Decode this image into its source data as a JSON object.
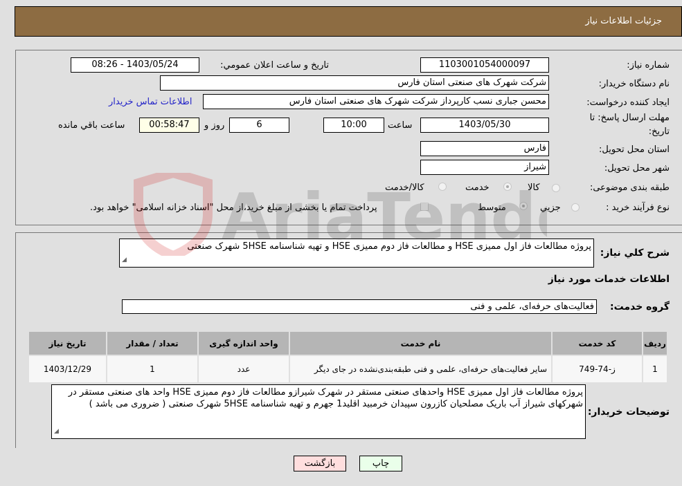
{
  "header": {
    "title": "جزئیات اطلاعات نیاز"
  },
  "fields": {
    "need_number_label": "شماره نیاز:",
    "need_number": "1103001054000097",
    "announce_label": "تاریخ و ساعت اعلان عمومي:",
    "announce_value": "1403/05/24 - 08:26",
    "buyer_org_label": "نام دستگاه خریدار:",
    "buyer_org": "شرکت شهرک های صنعتی استان فارس",
    "creator_label": "ایجاد کننده درخواست:",
    "creator": "محسن  جباری نسب کارپرداز شرکت شهرک های صنعتی استان فارس",
    "contact_link": "اطلاعات تماس خریدار",
    "deadline_label_1": "مهلت ارسال پاسخ: تا",
    "deadline_label_2": "تاریخ:",
    "deadline_date": "1403/05/30",
    "time_label": "ساعت",
    "deadline_time": "10:00",
    "days": "6",
    "days_label": "روز و",
    "remaining": "00:58:47",
    "remaining_label": "ساعت باقي مانده",
    "province_label": "استان محل تحویل:",
    "province": "فارس",
    "city_label": "شهر محل تحویل:",
    "city": "شیراز",
    "category_label": "طبقه بندی موضوعی:",
    "category_options": [
      {
        "label": "کالا",
        "selected": false
      },
      {
        "label": "خدمت",
        "selected": true
      },
      {
        "label": "کالا/خدمت",
        "selected": false
      }
    ],
    "process_label": "نوع فرآیند خرید :",
    "process_options": [
      {
        "label": "جزيي",
        "selected": false
      },
      {
        "label": "متوسط",
        "selected": true
      }
    ],
    "treasury_checkbox_label": "پرداخت تمام یا بخشی از مبلغ خرید،از محل \"اسناد خزانه اسلامی\" خواهد بود.",
    "treasury_checked": false
  },
  "description": {
    "label": "شرح كلي نیاز:",
    "value": "پروژه مطالعات فاز اول ممیزی HSE  و مطالعات فاز دوم ممیزی HSE  و تهیه شناسنامه   5HSE   شهرک صنعتی"
  },
  "services_title": "اطلاعات خدمات مورد نیاز",
  "service_group": {
    "label": "گروه خدمت:",
    "value": "فعالیت‌های حرفه‌ای، علمی و فنی"
  },
  "table": {
    "headers": [
      "ردیف",
      "کد خدمت",
      "نام خدمت",
      "واحد اندازه گیری",
      "تعداد / مقدار",
      "تاریخ نیاز"
    ],
    "rows": [
      [
        "1",
        "ز-74-749",
        "سایر فعالیت‌های حرفه‌ای، علمی و فنی طبقه‌بندی‌نشده در جای دیگر",
        "عدد",
        "1",
        "1403/12/29"
      ]
    ]
  },
  "buyer_notes": {
    "label": "توضیحات خریدار:",
    "value": "پروژه مطالعات فاز اول ممیزی HSE واحدهای صنعتی مستقر در شهرک شیرازو مطالعات فاز دوم ممیزی HSE واحد های صنعتی مستقر در شهرکهای شیراز  آب باریک  مصلحیان کازرون  سپیدان خرمبید اقلید1 جهرم و تهیه شناسنامه 5HSE شهرک صنعتی ( ضروری می باشد )"
  },
  "buttons": {
    "print": "چاپ",
    "back": "بازگشت"
  },
  "colors": {
    "header_bg": "#8d6c42",
    "print_bg": "#eaffea",
    "back_bg": "#ffdede",
    "link": "#2424c8"
  },
  "watermark_text": "AriaTender.neT"
}
